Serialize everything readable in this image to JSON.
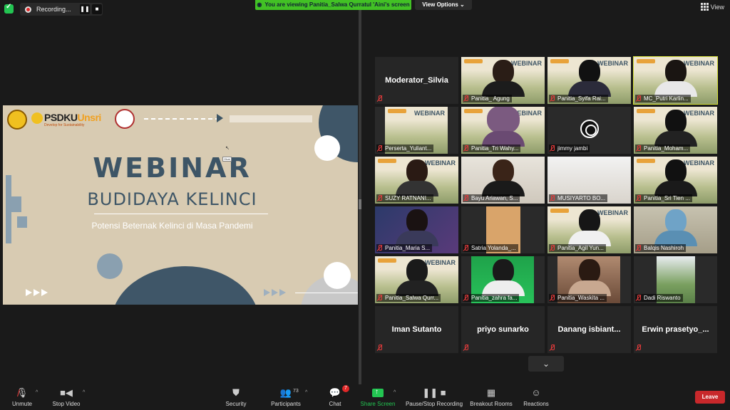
{
  "top_bar": {
    "recording_label": "Recording...",
    "viewing_banner": "You are viewing Panitia_Salwa Qurratul 'Aini's screen",
    "view_options": "View Options",
    "view_label": "View"
  },
  "slide": {
    "brand": "PSDKU",
    "brand_accent": "Unsri",
    "tagline": "Develop for Sustainability",
    "title": "WEBINAR",
    "subtitle": "BUDIDAYA KELINCI",
    "tagline2": "Potensi Beternak Kelinci di Masa Pandemi",
    "cursor_tooltip": "Obat"
  },
  "gallery": [
    {
      "name": "Moderator_Silvia"
    },
    {
      "name": "Panitia_ Agung"
    },
    {
      "name": "Panitia_Syifa Rai..."
    },
    {
      "name": "MC_Putri Karlin..."
    },
    {
      "name": "Perserta_Yuliant..."
    },
    {
      "name": "Panitia_Tri Wahy..."
    },
    {
      "name": "jimmy jambi"
    },
    {
      "name": "Panitia_Moham..."
    },
    {
      "name": "SUZY RATNANI..."
    },
    {
      "name": "Bayu Ariawan, S..."
    },
    {
      "name": "MUSIYARTO BO..."
    },
    {
      "name": "Panitia_Sri Tien ..."
    },
    {
      "name": "Panitia_Maria S..."
    },
    {
      "name": "Satria Yolanda_..."
    },
    {
      "name": "Panitia_Agil Yun..."
    },
    {
      "name": "Balqis Nashiroh"
    },
    {
      "name": "Panitia_Salwa Qurr..."
    },
    {
      "name": "Panitia_zahra fa..."
    },
    {
      "name": "Panitia_Waskita ..."
    },
    {
      "name": "Dadi Riswanto"
    },
    {
      "name": "Iman Sutanto"
    },
    {
      "name": "priyo sunarko"
    },
    {
      "name": "Danang  isbiant..."
    },
    {
      "name": "Erwin  prasetyo_..."
    }
  ],
  "toolbar": {
    "unmute": "Unmute",
    "stop_video": "Stop Video",
    "security": "Security",
    "participants": "Participants",
    "participants_count": "73",
    "chat": "Chat",
    "chat_badge": "7",
    "share_screen": "Share Screen",
    "pause_recording": "Pause/Stop Recording",
    "breakout": "Breakout Rooms",
    "reactions": "Reactions",
    "leave": "Leave"
  },
  "colors": {
    "accent_green": "#23c552",
    "leave_red": "#c8282b",
    "slide_bg": "#d8cbb2",
    "slide_navy": "#3d5566",
    "active_speaker": "#d8e23a"
  },
  "icons": [
    "shield-icon",
    "record-icon",
    "pause-icon",
    "stop-icon",
    "pin-icon",
    "chevron-down-icon",
    "grid-icon",
    "mic-off-icon",
    "video-icon",
    "security-icon",
    "participants-icon",
    "chat-icon",
    "share-screen-icon",
    "pause-stop-icon",
    "breakout-icon",
    "reactions-icon"
  ]
}
